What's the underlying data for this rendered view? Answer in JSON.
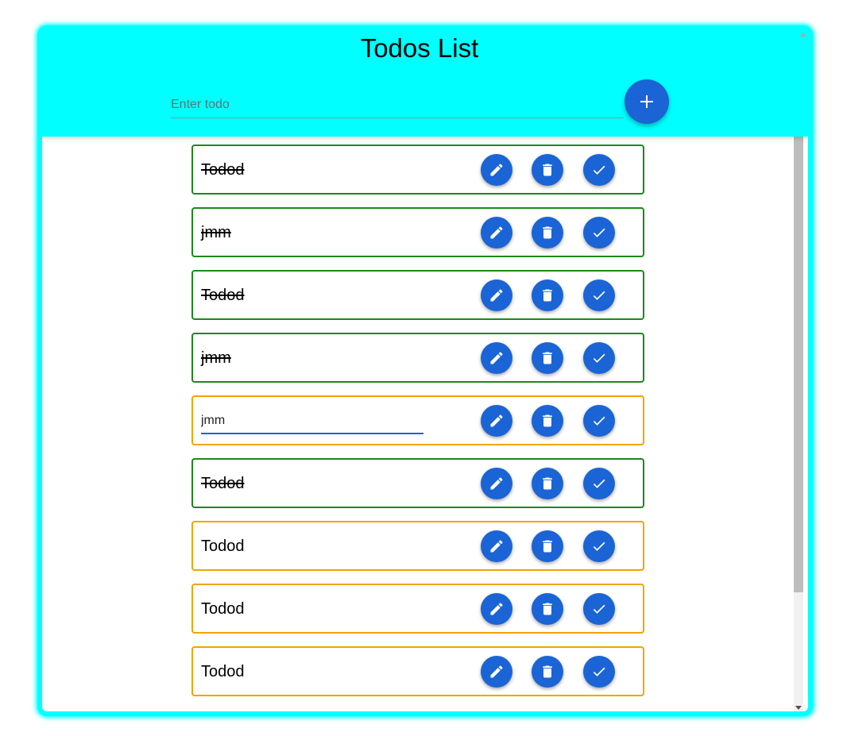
{
  "header": {
    "title": "Todos List",
    "input_placeholder": "Enter todo",
    "add_icon": "plus-icon"
  },
  "todos": [
    {
      "text": "Todod",
      "completed": true
    },
    {
      "text": "jmm",
      "completed": true
    },
    {
      "text": "Todod",
      "completed": true
    },
    {
      "text": "jmm",
      "completed": true
    },
    {
      "text": "jmm",
      "completed": false,
      "editing": true
    },
    {
      "text": "Todod",
      "completed": true
    },
    {
      "text": "Todod",
      "completed": false
    },
    {
      "text": "Todod",
      "completed": false
    },
    {
      "text": "Todod",
      "completed": false
    }
  ],
  "actions": {
    "edit_icon": "pencil-icon",
    "delete_icon": "trash-icon",
    "complete_icon": "check-icon"
  },
  "colors": {
    "accent": "#00ffff",
    "button": "#1a64d6",
    "completed_border": "#1a8a1a",
    "pending_border": "#f0a500"
  }
}
